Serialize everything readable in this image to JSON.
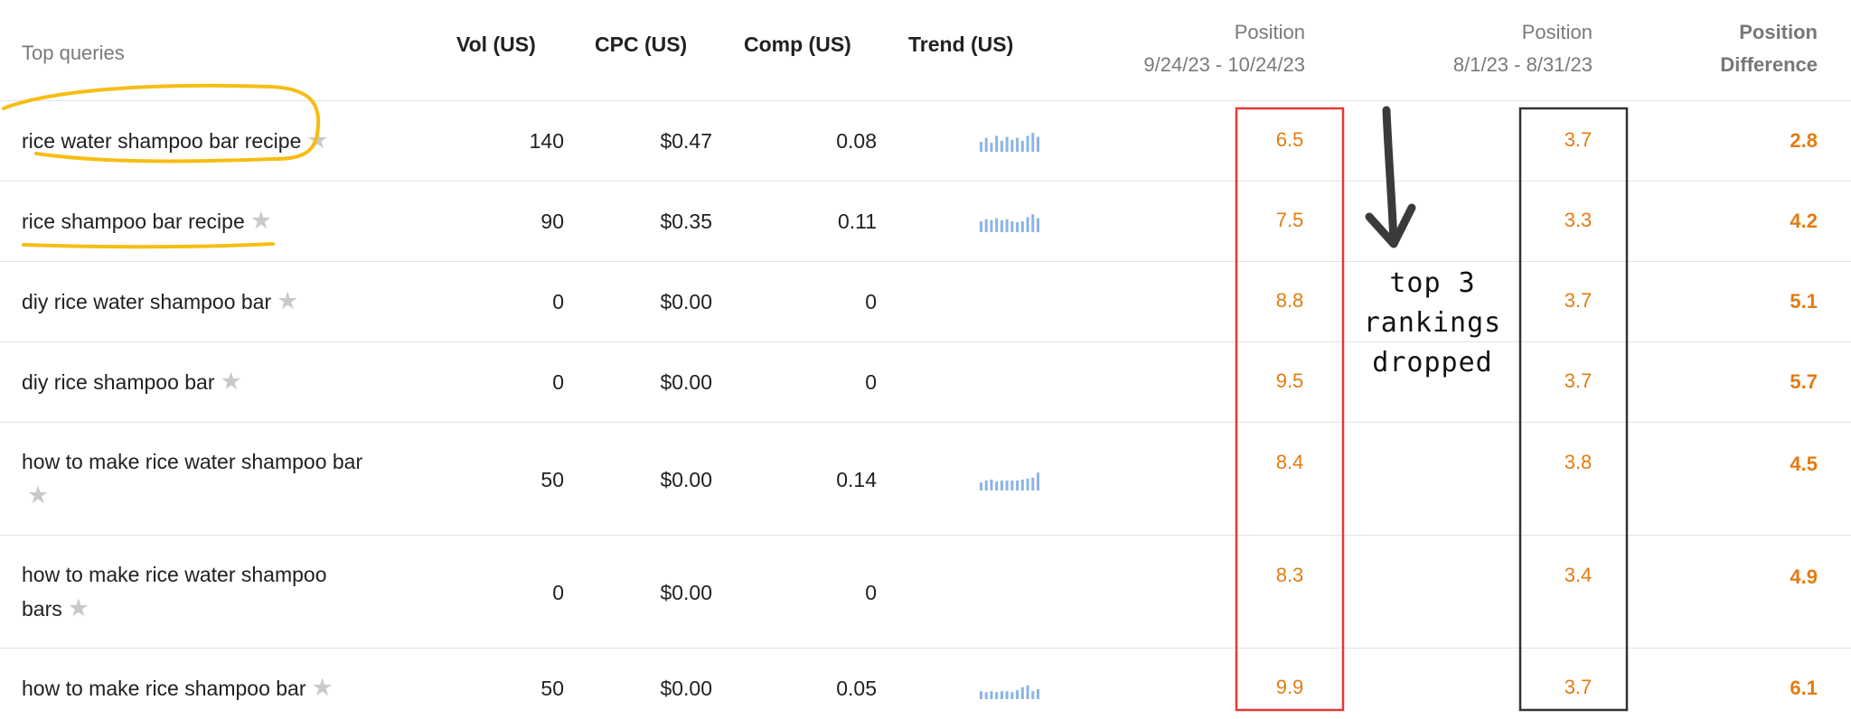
{
  "header": {
    "top_queries": "Top queries",
    "vol": "Vol (US)",
    "cpc": "CPC (US)",
    "comp": "Comp (US)",
    "trend": "Trend (US)",
    "pos1_title": "Position",
    "pos1_range": "9/24/23 - 10/24/23",
    "pos2_title": "Position",
    "pos2_range": "8/1/23 - 8/31/23",
    "diff_title": "Position",
    "diff_sub": "Difference"
  },
  "rows": [
    {
      "query": "rice water shampoo bar recipe",
      "vol": "140",
      "cpc": "$0.47",
      "comp": "0.08",
      "trend": [
        0.5,
        0.7,
        0.45,
        0.8,
        0.55,
        0.75,
        0.6,
        0.7,
        0.55,
        0.8,
        0.95,
        0.75
      ],
      "pos_recent": "6.5",
      "pos_old": "3.7",
      "diff": "2.8"
    },
    {
      "query": "rice shampoo bar recipe",
      "vol": "90",
      "cpc": "$0.35",
      "comp": "0.11",
      "trend": [
        0.55,
        0.65,
        0.6,
        0.7,
        0.6,
        0.65,
        0.55,
        0.5,
        0.55,
        0.75,
        0.9,
        0.7
      ],
      "pos_recent": "7.5",
      "pos_old": "3.3",
      "diff": "4.2"
    },
    {
      "query": "diy rice water shampoo bar",
      "vol": "0",
      "cpc": "$0.00",
      "comp": "0",
      "trend": null,
      "pos_recent": "8.8",
      "pos_old": "3.7",
      "diff": "5.1"
    },
    {
      "query": "diy rice shampoo bar",
      "vol": "0",
      "cpc": "$0.00",
      "comp": "0",
      "trend": null,
      "pos_recent": "9.5",
      "pos_old": "3.7",
      "diff": "5.7"
    },
    {
      "query": "how to make rice water shampoo bar",
      "vol": "50",
      "cpc": "$0.00",
      "comp": "0.14",
      "trend": [
        0.4,
        0.5,
        0.55,
        0.45,
        0.5,
        0.5,
        0.5,
        0.5,
        0.55,
        0.6,
        0.65,
        0.9
      ],
      "pos_recent": "8.4",
      "pos_old": "3.8",
      "diff": "4.5"
    },
    {
      "query": "how to make rice water shampoo bars",
      "vol": "0",
      "cpc": "$0.00",
      "comp": "0",
      "trend": null,
      "pos_recent": "8.3",
      "pos_old": "3.4",
      "diff": "4.9"
    },
    {
      "query": "how to make rice shampoo bar",
      "vol": "50",
      "cpc": "$0.00",
      "comp": "0.05",
      "trend": [
        0.4,
        0.35,
        0.4,
        0.35,
        0.4,
        0.4,
        0.35,
        0.45,
        0.6,
        0.7,
        0.4,
        0.5
      ],
      "pos_recent": "9.9",
      "pos_old": "3.7",
      "diff": "6.1"
    }
  ],
  "annotation": {
    "line1": "top 3",
    "line2": "rankings",
    "line3": "dropped"
  },
  "colors": {
    "position_text": "#e37b10",
    "trend_bar": "#8ab4e8",
    "highlight_yellow": "#f6bd12",
    "box_red": "#e53935",
    "box_dark": "#333333"
  }
}
